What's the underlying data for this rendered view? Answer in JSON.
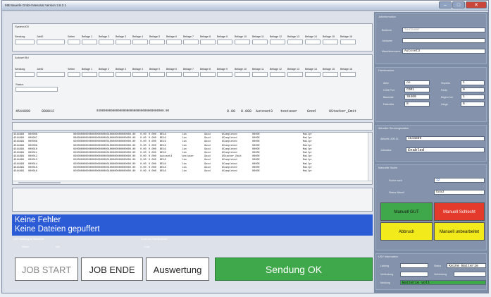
{
  "window": {
    "title": "MB Bauerle GmbH Messsat Version 3.8.2.1"
  },
  "panels": {
    "system": "System400",
    "autoset": "Autoset Bd",
    "status": "Status"
  },
  "table1": {
    "headers": [
      "Sendung",
      "JobID",
      "Seiten",
      "Beilage 1",
      "Beilage 2",
      "Beilage 3",
      "Beilage 4",
      "Beilage 5",
      "Beilage 6",
      "Beilage 7",
      "Beilage 8",
      "Beilage 9",
      "Beilage 10",
      "Beilage 11",
      "Beilage 12",
      "Beilage 13",
      "Beilage 14",
      "Beilage 15",
      "Beilage 16"
    ]
  },
  "table2": {
    "headers": [
      "Sendung",
      "JobID",
      "Seiten",
      "Beilage 1",
      "Beilage 2",
      "Beilage 3",
      "Beilage 4",
      "Beilage 5",
      "Beilage 6",
      "Beilage 7",
      "Beilage 8",
      "Beilage 9",
      "Beilage 10",
      "Beilage 11",
      "Beilage 12",
      "Beilage 13",
      "Beilage 14",
      "Beilage 15",
      "Beilage 16"
    ]
  },
  "status_line": {
    "sendung": "4544899",
    "jobid": "000012",
    "code": "03000000000000000000000000000000000000.00",
    "val1": "0.00",
    "val2": "0.000",
    "set": "Autoset3",
    "user": "testuser",
    "result": "Good",
    "stacker": "8Stacker_Emit"
  },
  "log": {
    "rows": [
      {
        "id": "4544898",
        "job": "000006",
        "code": "00000000000000000000000100000000000000.00",
        "a": "0.00",
        "b": "0.000",
        "c": "BE16",
        "d": "lim",
        "e": "Good",
        "f": "8Completed",
        "g": "0000E",
        "h": "Mailpr"
      },
      {
        "id": "4544899",
        "job": "000007",
        "code": "00000000000000000000000100000000000000.00",
        "a": "0.00",
        "b": "0.000",
        "c": "BE16",
        "d": "lim",
        "e": "Good",
        "f": "8Completed",
        "g": "0000E",
        "h": "Mailpr"
      },
      {
        "id": "4544899",
        "job": "000008",
        "code": "02000000000000000000000100000000000000.00",
        "a": "0.00",
        "b": "0.000",
        "c": "BE16",
        "d": "lim",
        "e": "Good",
        "f": "8Completed",
        "g": "0000E",
        "h": "Mailpr"
      },
      {
        "id": "4544899",
        "job": "000009",
        "code": "02000000000000000000000100000000000000.00",
        "a": "0.00",
        "b": "0.000",
        "c": "BE16",
        "d": "lim",
        "e": "Good",
        "f": "8Completed",
        "g": "0000E",
        "h": "Mailpr"
      },
      {
        "id": "4544899",
        "job": "000010",
        "code": "02000000000000000000000100000000000000.00",
        "a": "0.00",
        "b": "0.000",
        "c": "BE16",
        "d": "lim",
        "e": "Good",
        "f": "8Completed",
        "g": "0000E",
        "h": "Mailpr"
      },
      {
        "id": "4544899",
        "job": "000011",
        "code": "02000000000000000000000100000000000000.00",
        "a": "0.00",
        "b": "0.000",
        "c": "BE16",
        "d": "lim",
        "e": "Good",
        "f": "8Completed",
        "g": "0000E",
        "h": "Mailpr"
      },
      {
        "id": "4544899",
        "job": "000012",
        "code": "03000000000000000000000000000000000000.00",
        "a": "0.00",
        "b": "0.000",
        "c": "Autoset3",
        "d": "testuser",
        "e": "Good",
        "f": "8Stacker_Emit",
        "g": "0000E",
        "h": "Mailpr"
      },
      {
        "id": "4544899",
        "job": "000013",
        "code": "02000000000000000000000100000000000000.00",
        "a": "0.00",
        "b": "0.000",
        "c": "BE16",
        "d": "lim",
        "e": "Good",
        "f": "8Completed",
        "g": "0000E",
        "h": "Mailpr"
      },
      {
        "id": "4544899",
        "job": "000014",
        "code": "02000000000000000000000100000000000000.00",
        "a": "0.00",
        "b": "0.000",
        "c": "BE16",
        "d": "lim",
        "e": "Good",
        "f": "8Completed",
        "g": "0000E",
        "h": "Mailpr"
      },
      {
        "id": "4544899",
        "job": "000015",
        "code": "04000000000000000000000100000000000000.00",
        "a": "0.00",
        "b": "0.000",
        "c": "BE16",
        "d": "lim",
        "e": "Good",
        "f": "8Completed",
        "g": "0000E",
        "h": "Mailpr"
      },
      {
        "id": "4544899",
        "job": "000016",
        "code": "02000000000000000000000100000000000000.00",
        "a": "0.00",
        "b": "0.000",
        "c": "BE16",
        "d": "lim",
        "e": "Good",
        "f": "8Completed",
        "g": "0000E",
        "h": "Mailpr"
      }
    ]
  },
  "messages": {
    "line1": "Keine Fehler",
    "line2": "Keine Dateien gepuffert"
  },
  "bottom_labels": {
    "meldung": "UDP Meldung an Maschine",
    "code_scanner": "Code von Handscanner",
    "status": "Status",
    "info": "Info",
    "code": "Code"
  },
  "buttons": {
    "job_start": "JOB START",
    "job_ende": "JOB ENDE",
    "auswertung": "Auswertung",
    "sendung_ok": "Sendung OK"
  },
  "jobinfo": {
    "title": "Jobinformation",
    "bediener_label": "Bediener",
    "bediener": "testuser",
    "jobname_label": "Jobname",
    "jobname": "",
    "maschinenname_label": "Maschinenname",
    "maschinenname": "Autoset3"
  },
  "handscanner": {
    "title": "Handscanner",
    "aktiv_label": "Aktiv",
    "aktiv": "on",
    "com_label": "COM Port",
    "com": "COM1",
    "baud_label": "Baudrate",
    "baud": "38400",
    "datenbits_label": "Datenbits",
    "datenbits": "8",
    "stopbits_label": "Stopbits",
    "stopbits": "1",
    "parity_label": "Parity",
    "parity": "0",
    "beginn_label": "Beginn bei",
    "beginn": "1",
    "laenge_label": "Länge",
    "laenge": "6"
  },
  "sendung": {
    "title": "Aktueller Sendungsstatus",
    "jobid_label": "Aktuelle JOB ID",
    "jobid": "4544899",
    "jobstatus_label": "Jobstatus",
    "jobstatus": "Enabled"
  },
  "manual": {
    "title": "Manuelle Suche",
    "suche_label": "Suche nach",
    "suche": "12",
    "status_label": "Status Aktuell",
    "status": "Good",
    "gut": "Manuell GUT",
    "schlecht": "Manuell Schlecht",
    "abbruch": "Abbruch",
    "unbearbeitet": "Manuell unbearbeitet"
  },
  "usv": {
    "title": "USV Information",
    "ladung_label": "Ladung",
    "ladung": "",
    "status_label": "Status",
    "status": "Keine Batterie",
    "verbindung_label": "Verbindung",
    "verbindung": "",
    "meldung_label": "Meldung",
    "meldung": "Batterie voll"
  },
  "colors": {
    "green": "#3fa84a",
    "red": "#e33a2c",
    "yellow": "#f2ea1b",
    "blue": "#2c5bd6"
  }
}
